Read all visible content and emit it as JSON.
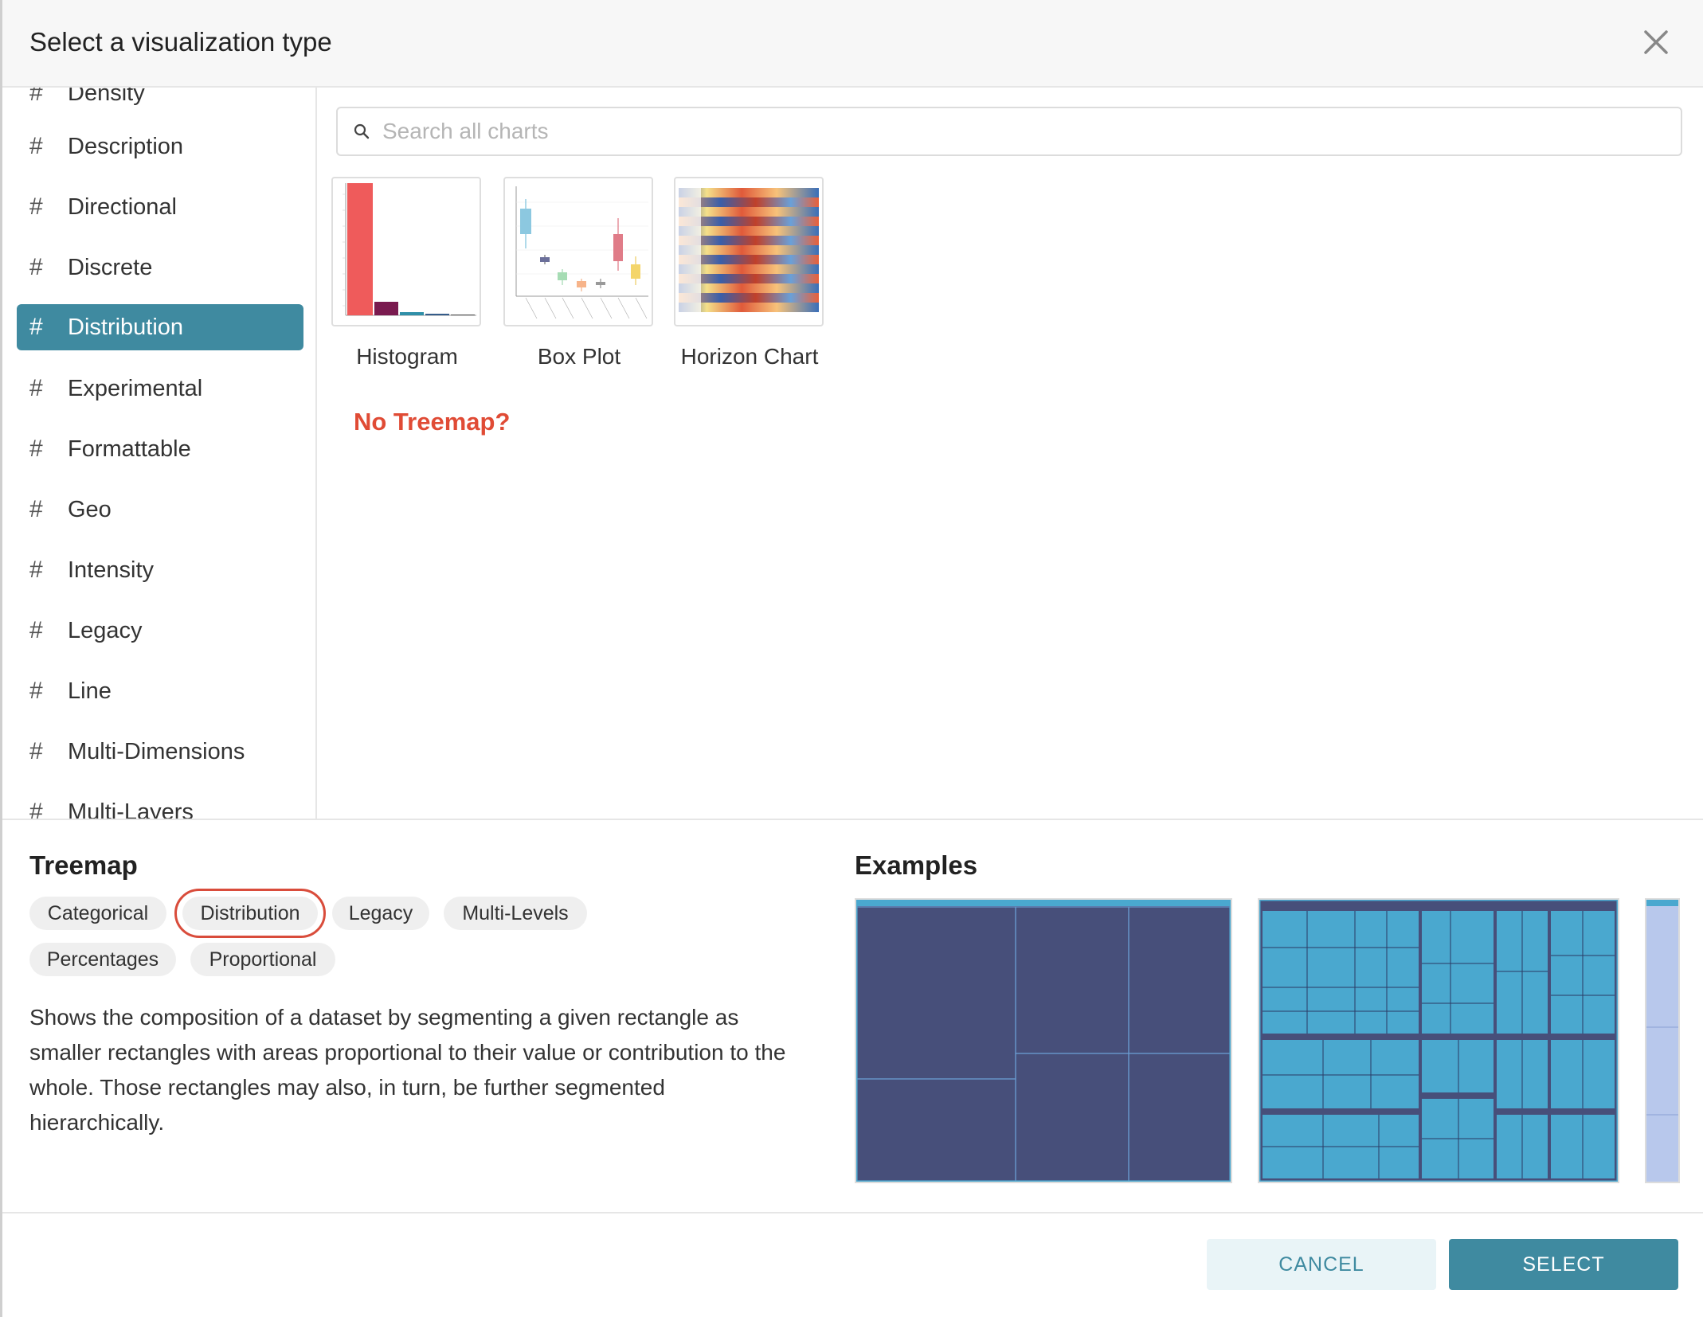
{
  "modal": {
    "title": "Select a visualization type"
  },
  "sidebar": {
    "items": [
      {
        "label": "Density"
      },
      {
        "label": "Description"
      },
      {
        "label": "Directional"
      },
      {
        "label": "Discrete"
      },
      {
        "label": "Distribution",
        "active": true
      },
      {
        "label": "Experimental"
      },
      {
        "label": "Formattable"
      },
      {
        "label": "Geo"
      },
      {
        "label": "Intensity"
      },
      {
        "label": "Legacy"
      },
      {
        "label": "Line"
      },
      {
        "label": "Multi-Dimensions"
      },
      {
        "label": "Multi-Layers"
      }
    ]
  },
  "search": {
    "placeholder": "Search all charts"
  },
  "charts": [
    {
      "label": "Histogram"
    },
    {
      "label": "Box Plot"
    },
    {
      "label": "Horizon Chart"
    }
  ],
  "annotation": {
    "text": "No Treemap?"
  },
  "detail": {
    "title": "Treemap",
    "tags": [
      "Categorical",
      "Distribution",
      "Legacy",
      "Multi-Levels",
      "Percentages",
      "Proportional"
    ],
    "description": "Shows the composition of a dataset by segmenting a given rectangle as smaller rectangles with areas proportional to their value or contribution to the whole. Those rectangles may also, in turn, be further segmented hierarchically."
  },
  "examples": {
    "title": "Examples"
  },
  "footer": {
    "cancel_label": "CANCEL",
    "select_label": "SELECT"
  },
  "colors": {
    "accent": "#3f8aa0",
    "highlight": "#d94c3b",
    "annotation": "#e04b35",
    "treemap_dark": "#474f7a",
    "treemap_light": "#4aa8cf"
  }
}
